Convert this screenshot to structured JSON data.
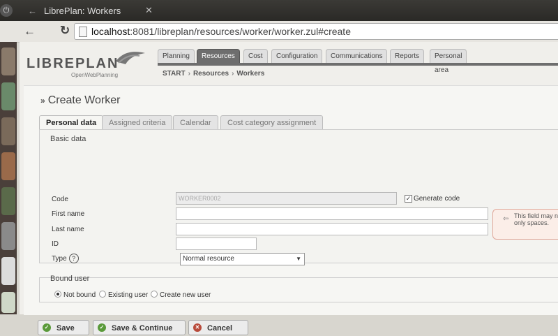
{
  "window": {
    "title": "LibrePlan: Workers"
  },
  "browser": {
    "url_host": "localhost",
    "url_rest": ":8081/libreplan/resources/worker/worker.zul#create"
  },
  "logo": {
    "name": "LIBREPLAN",
    "tagline": "OpenWebPlanning"
  },
  "main_tabs": [
    "Planning",
    "Resources",
    "Cost",
    "Configuration",
    "Communications",
    "Reports",
    "Personal area"
  ],
  "breadcrumb": [
    "START",
    "Resources",
    "Workers"
  ],
  "heading": "Create Worker",
  "sub_tabs": [
    "Personal data",
    "Assigned criteria",
    "Calendar",
    "Cost category assignment"
  ],
  "basic_data": {
    "legend": "Basic data",
    "code_label": "Code",
    "code_value": "WORKER0002",
    "generate_code": "Generate code",
    "first_name_label": "First name",
    "last_name_label": "Last name",
    "id_label": "ID",
    "type_label": "Type",
    "type_value": "Normal resource"
  },
  "tooltip": {
    "line1": "This field may n",
    "line2": "only spaces."
  },
  "bound_user": {
    "legend": "Bound user",
    "options": [
      "Not bound",
      "Existing user",
      "Create new user"
    ]
  },
  "buttons": {
    "save": "Save",
    "save_continue": "Save & Continue",
    "cancel": "Cancel"
  }
}
